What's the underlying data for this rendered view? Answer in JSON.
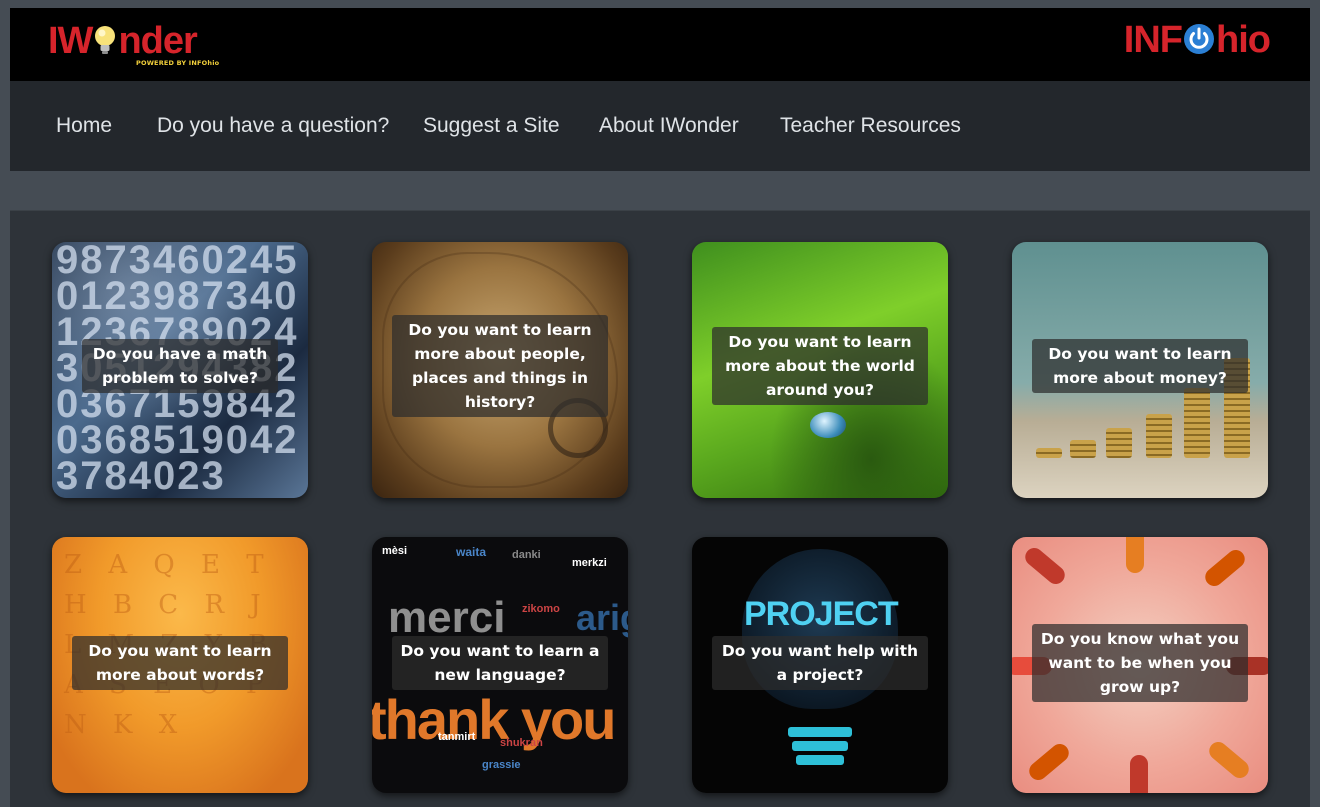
{
  "header": {
    "logo_text_1": "IW",
    "logo_text_2": "nder",
    "logo_powered": "POWERED BY INFOhio",
    "partner_logo_1": "INF",
    "partner_logo_2": "hio"
  },
  "nav": {
    "items": [
      {
        "label": "Home"
      },
      {
        "label": "Do you have a question?"
      },
      {
        "label": "Suggest a Site"
      },
      {
        "label": "About IWonder"
      },
      {
        "label": "Teacher Resources"
      }
    ]
  },
  "tiles": [
    {
      "caption": "Do you have a math problem to solve?"
    },
    {
      "caption": "Do you want to learn more about people, places and things in history?"
    },
    {
      "caption": "Do you want to learn more about the world around you?"
    },
    {
      "caption": "Do you want to learn more about money?"
    },
    {
      "caption": "Do you want to learn more about words?"
    },
    {
      "caption": "Do you want to learn a new language?"
    },
    {
      "caption": "Do you want help with a project?"
    },
    {
      "caption": "Do you know what you want to be when you grow up?"
    }
  ],
  "tile_art": {
    "math_digits": "9873460245012398734012367890243051294382036715984203685190423784023",
    "word_letters": "Z A Q E T H B C R J L M Z Y B A S E O P N K X",
    "language_words": [
      "waita",
      "danki",
      "merkzi",
      "merci",
      "arig",
      "thank you",
      "zikomo",
      "mèsi",
      "grassie",
      "shukran",
      "tanmirt"
    ],
    "project_word": "PROJECT"
  },
  "colors": {
    "accent_red": "#d6242b",
    "accent_yellow": "#f2d03b",
    "nav_bg": "#23272c",
    "header_bg": "#000000",
    "page_bg": "#454c54",
    "panel_bg": "#2e3339"
  }
}
